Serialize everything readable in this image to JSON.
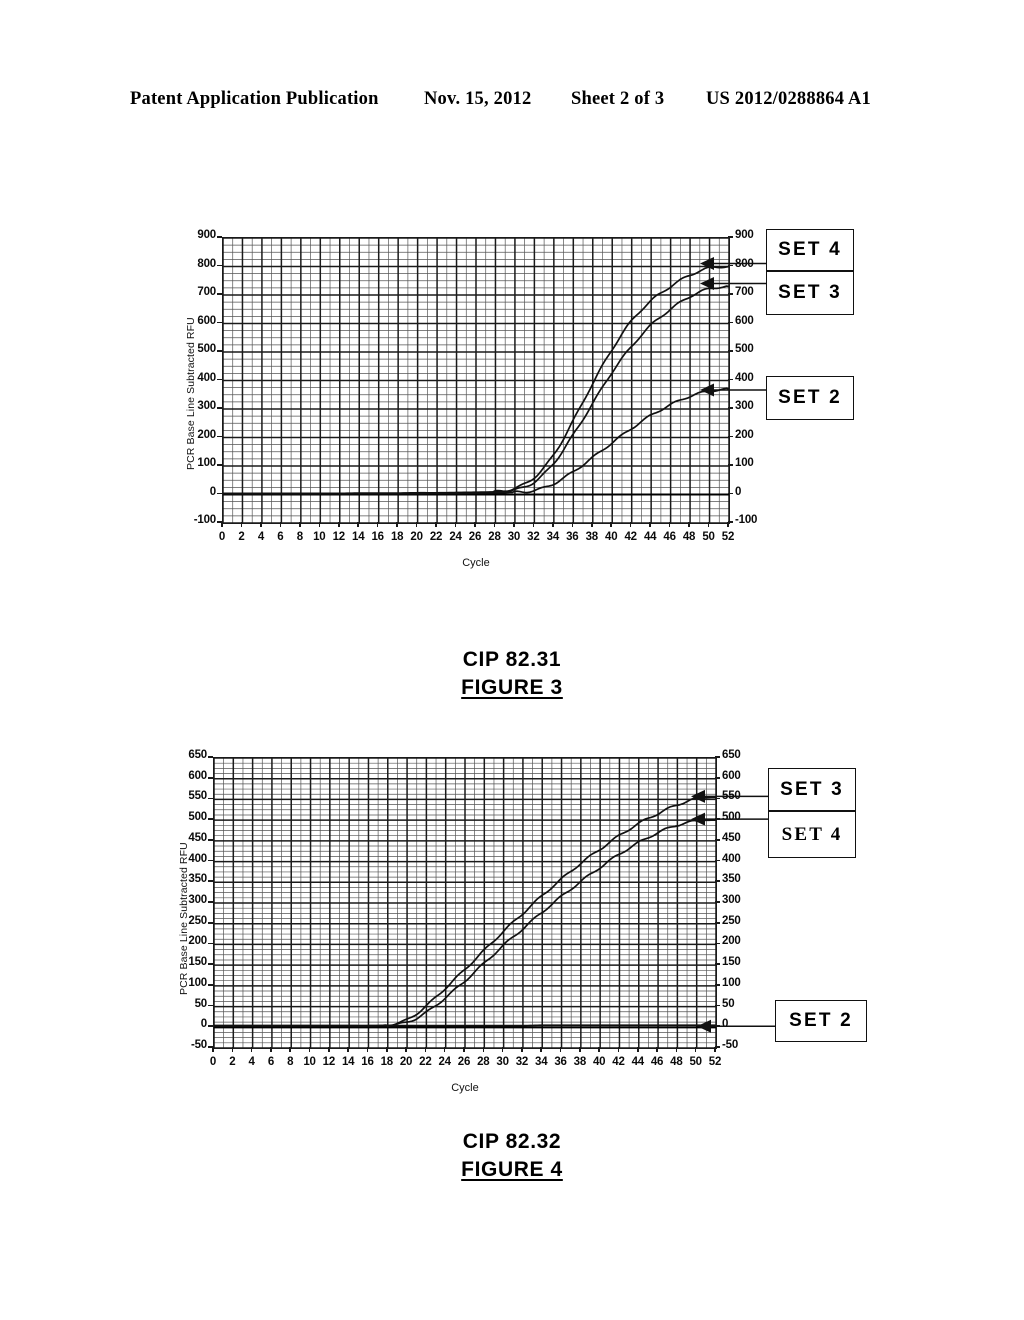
{
  "header": {
    "left": "Patent Application Publication",
    "date": "Nov. 15, 2012",
    "sheet": "Sheet 2 of 3",
    "doc_number": "US 2012/0288864 A1"
  },
  "figures": [
    {
      "code": "CIP 82.31",
      "figure_label": "FIGURE 3",
      "callouts": [
        {
          "label": "SET  4",
          "font": "sans"
        },
        {
          "label": "SET  3",
          "font": "sans"
        },
        {
          "label": "SET  2",
          "font": "sans"
        }
      ]
    },
    {
      "code": "CIP 82.32",
      "figure_label": "FIGURE 4",
      "callouts": [
        {
          "label": "SET  3",
          "font": "sans"
        },
        {
          "label": "SET  4",
          "font": "serif"
        },
        {
          "label": "SET  2",
          "font": "sans"
        }
      ]
    }
  ],
  "chart_data": [
    {
      "type": "line",
      "title": "CIP 82.31 / FIGURE 3",
      "xlabel": "Cycle",
      "ylabel": "PCR Base Line Subtracted RFU",
      "xlim": [
        0,
        52
      ],
      "ylim": [
        -100,
        900
      ],
      "xticks": [
        0,
        2,
        4,
        6,
        8,
        10,
        12,
        14,
        16,
        18,
        20,
        22,
        24,
        26,
        28,
        30,
        32,
        34,
        36,
        38,
        40,
        42,
        44,
        46,
        48,
        50,
        52
      ],
      "yticks": [
        -100,
        0,
        100,
        200,
        300,
        400,
        500,
        600,
        700,
        800,
        900
      ],
      "grid": true,
      "grid_minor_x_step": 1,
      "grid_minor_y_step": 25,
      "legend_position": "right-callouts",
      "line_color": "#111111",
      "x": [
        0,
        2,
        4,
        6,
        8,
        10,
        12,
        14,
        16,
        18,
        20,
        22,
        24,
        26,
        28,
        30,
        32,
        34,
        36,
        38,
        40,
        42,
        44,
        46,
        48,
        50,
        52
      ],
      "series": [
        {
          "name": "SET 4",
          "endpoint_value": 800,
          "values": [
            4,
            4,
            4,
            4,
            4,
            4,
            4,
            5,
            5,
            5,
            6,
            6,
            7,
            8,
            10,
            22,
            60,
            140,
            260,
            390,
            510,
            610,
            680,
            730,
            770,
            795,
            800
          ]
        },
        {
          "name": "SET 3",
          "endpoint_value": 730,
          "values": [
            3,
            3,
            3,
            3,
            3,
            3,
            3,
            4,
            4,
            4,
            5,
            5,
            6,
            7,
            9,
            16,
            44,
            110,
            210,
            320,
            430,
            520,
            595,
            650,
            695,
            722,
            730
          ]
        },
        {
          "name": "SET 2",
          "endpoint_value": 370,
          "values": [
            2,
            2,
            2,
            2,
            2,
            2,
            2,
            3,
            3,
            3,
            3,
            4,
            4,
            5,
            6,
            8,
            14,
            38,
            80,
            130,
            182,
            232,
            278,
            315,
            345,
            363,
            370
          ]
        }
      ]
    },
    {
      "type": "line",
      "title": "CIP 82.32 / FIGURE 4",
      "xlabel": "Cycle",
      "ylabel": "PCR Base Line Subtracted RFU",
      "xlim": [
        0,
        52
      ],
      "ylim": [
        -50,
        650
      ],
      "xticks": [
        0,
        2,
        4,
        6,
        8,
        10,
        12,
        14,
        16,
        18,
        20,
        22,
        24,
        26,
        28,
        30,
        32,
        34,
        36,
        38,
        40,
        42,
        44,
        46,
        48,
        50,
        52
      ],
      "yticks": [
        -50,
        0,
        50,
        100,
        150,
        200,
        250,
        300,
        350,
        400,
        450,
        500,
        550,
        600,
        650
      ],
      "grid": true,
      "grid_minor_x_step": 1,
      "grid_minor_y_step": 12.5,
      "legend_position": "right-callouts",
      "line_color": "#111111",
      "x": [
        0,
        2,
        4,
        6,
        8,
        10,
        12,
        14,
        16,
        18,
        20,
        22,
        24,
        26,
        28,
        30,
        32,
        34,
        36,
        38,
        40,
        42,
        44,
        46,
        48,
        50,
        52
      ],
      "series": [
        {
          "name": "SET 3",
          "endpoint_value": 555,
          "values": [
            4,
            4,
            4,
            4,
            4,
            4,
            4,
            4,
            4,
            6,
            18,
            52,
            95,
            140,
            186,
            232,
            275,
            318,
            358,
            396,
            430,
            463,
            492,
            516,
            537,
            552,
            555
          ]
        },
        {
          "name": "SET 4",
          "endpoint_value": 500,
          "values": [
            3,
            3,
            3,
            3,
            3,
            3,
            3,
            3,
            3,
            5,
            12,
            36,
            72,
            112,
            155,
            198,
            238,
            278,
            316,
            352,
            386,
            418,
            446,
            470,
            488,
            498,
            500
          ]
        },
        {
          "name": "SET 2",
          "endpoint_value": 5,
          "values": [
            4,
            4,
            4,
            4,
            4,
            4,
            4,
            4,
            4,
            4,
            4,
            4,
            4,
            4,
            4,
            4,
            4,
            5,
            5,
            5,
            5,
            5,
            5,
            5,
            5,
            5,
            5
          ]
        }
      ]
    }
  ]
}
